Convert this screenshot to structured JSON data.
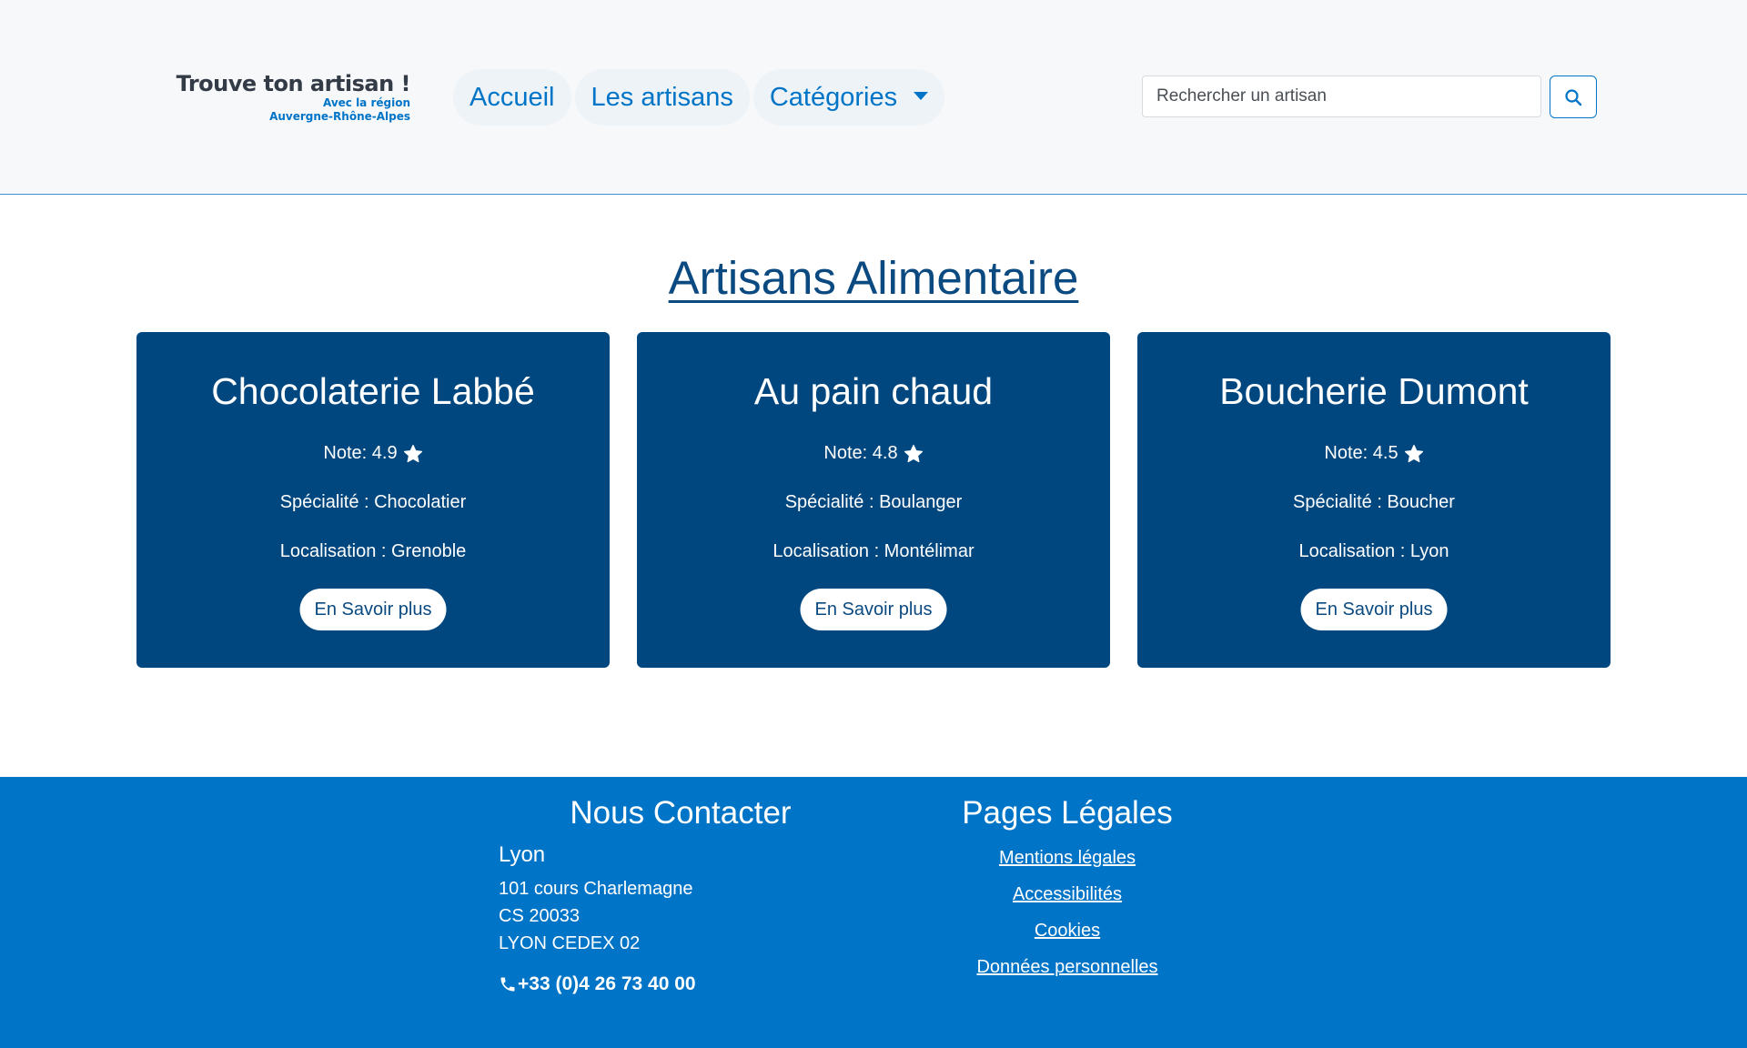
{
  "header": {
    "logo": {
      "title": "Trouve ton artisan !",
      "subtitle_line1": "Avec la région",
      "subtitle_line2": "Auvergne-Rhône-Alpes"
    },
    "nav": [
      {
        "label": "Accueil"
      },
      {
        "label": "Les artisans"
      },
      {
        "label": "Catégories",
        "icon": "caret-down-icon"
      }
    ],
    "search": {
      "placeholder": "Rechercher un artisan",
      "value": "",
      "button_icon": "search-icon"
    }
  },
  "main": {
    "title": "Artisans Alimentaire",
    "cards": [
      {
        "name": "Chocolaterie Labbé",
        "note": "Note: 4.9",
        "specialite": "Spécialité : Chocolatier",
        "localisation": "Localisation : Grenoble",
        "button": "En Savoir plus"
      },
      {
        "name": "Au pain chaud",
        "note": "Note: 4.8",
        "specialite": "Spécialité : Boulanger",
        "localisation": "Localisation : Montélimar",
        "button": "En Savoir plus"
      },
      {
        "name": "Boucherie Dumont",
        "note": "Note: 4.5",
        "specialite": "Spécialité : Boucher",
        "localisation": "Localisation : Lyon",
        "button": "En Savoir plus"
      }
    ]
  },
  "footer": {
    "contact": {
      "heading": "Nous Contacter",
      "city": "Lyon",
      "address_lines": [
        "101 cours Charlemagne",
        "CS 20033",
        "LYON CEDEX 02"
      ],
      "phone": "+33 (0)4 26 73 40 00",
      "phone_icon": "phone-icon"
    },
    "legal": {
      "heading": "Pages Légales",
      "links": [
        "Mentions légales",
        "Accessibilités",
        "Cookies",
        "Données personnelles"
      ]
    }
  },
  "colors": {
    "primary": "#0074c7",
    "card_bg": "#01477f",
    "title": "#0b4a80",
    "header_bg": "#f6f8fa"
  }
}
